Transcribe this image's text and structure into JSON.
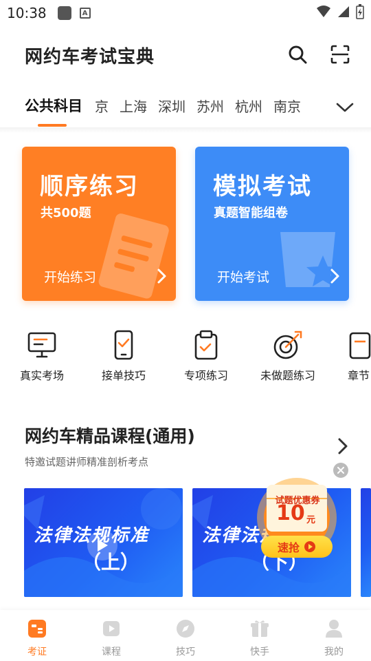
{
  "status_bar": {
    "time": "10:38"
  },
  "header": {
    "title": "网约车考试宝典"
  },
  "tabs": {
    "items": [
      "公共科目",
      "京",
      "上海",
      "深圳",
      "苏州",
      "杭州",
      "南京"
    ],
    "active_index": 0
  },
  "cards": {
    "sequential": {
      "title": "顺序练习",
      "subtitle": "共500题",
      "action": "开始练习",
      "color": "#ff7f24"
    },
    "mock": {
      "title": "模拟考试",
      "subtitle": "真题智能组卷",
      "action": "开始考试",
      "color": "#3d8cf7"
    }
  },
  "quick_entries": [
    {
      "label": "真实考场",
      "icon": "monitor-icon"
    },
    {
      "label": "接单技巧",
      "icon": "phone-check-icon"
    },
    {
      "label": "专项练习",
      "icon": "clipboard-icon"
    },
    {
      "label": "未做题练习",
      "icon": "target-icon"
    },
    {
      "label": "章节",
      "icon": "book-icon"
    }
  ],
  "section": {
    "title": "网约车精品课程(通用)",
    "subtitle": "特邀试题讲师精准剖析考点"
  },
  "courses": [
    {
      "title": "法律法规标准",
      "part": "（上）"
    },
    {
      "title": "法律法规标准",
      "part": "（下）"
    }
  ],
  "coupon": {
    "label": "试题优惠券",
    "value": "10",
    "unit": "元",
    "button": "速抢"
  },
  "bottom_nav": [
    {
      "label": "考证",
      "icon": "id-card-icon"
    },
    {
      "label": "课程",
      "icon": "video-icon"
    },
    {
      "label": "技巧",
      "icon": "compass-icon"
    },
    {
      "label": "快手",
      "icon": "gift-icon"
    },
    {
      "label": "我的",
      "icon": "user-icon"
    }
  ],
  "colors": {
    "accent": "#ff7a22",
    "blue": "#3d8cf7",
    "orange": "#ff7f24"
  }
}
